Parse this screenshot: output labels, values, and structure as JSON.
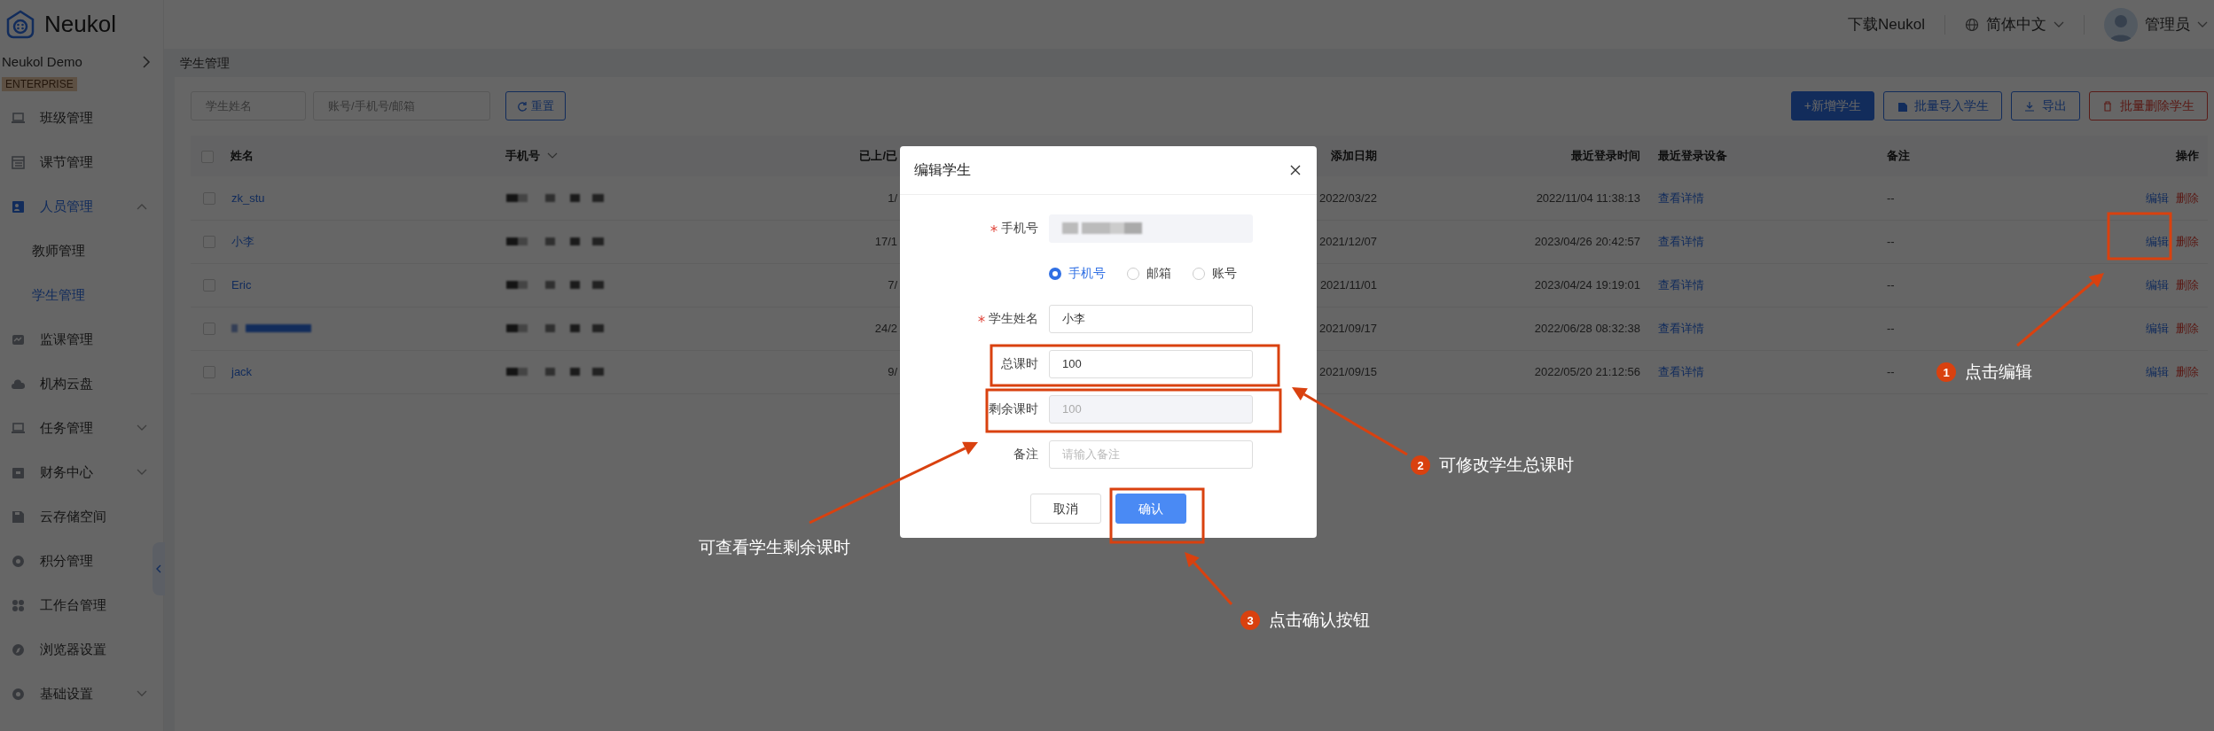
{
  "brand": {
    "name": "Neukol"
  },
  "org": {
    "name": "Neukol Demo",
    "badge": "ENTERPRISE"
  },
  "sidebar": {
    "items": [
      {
        "label": "班级管理",
        "kind": "link",
        "expanded": false,
        "selected": false
      },
      {
        "label": "课节管理",
        "kind": "link",
        "expanded": false,
        "selected": false
      },
      {
        "label": "人员管理",
        "kind": "group",
        "expanded": true,
        "selected": false,
        "children": [
          {
            "label": "教师管理",
            "selected": false
          },
          {
            "label": "学生管理",
            "selected": true
          }
        ]
      },
      {
        "label": "监课管理",
        "kind": "link",
        "expanded": false,
        "selected": false
      },
      {
        "label": "机构云盘",
        "kind": "link",
        "expanded": false,
        "selected": false
      },
      {
        "label": "任务管理",
        "kind": "group",
        "expanded": false,
        "selected": false
      },
      {
        "label": "财务中心",
        "kind": "group",
        "expanded": false,
        "selected": false
      },
      {
        "label": "云存储空间",
        "kind": "link",
        "expanded": false,
        "selected": false
      },
      {
        "label": "积分管理",
        "kind": "link",
        "expanded": false,
        "selected": false
      },
      {
        "label": "工作台管理",
        "kind": "link",
        "expanded": false,
        "selected": false
      },
      {
        "label": "浏览器设置",
        "kind": "link",
        "expanded": false,
        "selected": false
      },
      {
        "label": "基础设置",
        "kind": "group",
        "expanded": false,
        "selected": false
      }
    ]
  },
  "topbar": {
    "download": "下载Neukol",
    "language": "简体中文",
    "user": "管理员"
  },
  "breadcrumb": "学生管理",
  "filters": {
    "name_placeholder": "学生姓名",
    "account_placeholder": "账号/手机号/邮箱",
    "reset": "重置"
  },
  "actions": [
    {
      "label": "+新增学生",
      "kind": "primary"
    },
    {
      "label": "批量导入学生",
      "kind": "import"
    },
    {
      "label": "导出",
      "kind": "export"
    },
    {
      "label": "批量删除学生",
      "kind": "danger"
    }
  ],
  "table": {
    "header_checked": false,
    "columns": [
      "姓名",
      "手机号",
      "已上/已",
      "添加日期",
      "最近登录时间",
      "最近登录设备",
      "备注",
      "操作"
    ],
    "rows": [
      {
        "checked": false,
        "name": "zk_stu",
        "lessons": "1/",
        "added": "2022/03/22",
        "last_login": "2022/11/04 11:38:13",
        "device": "查看详情",
        "note": "--",
        "edit": "编辑",
        "delete": "删除"
      },
      {
        "checked": false,
        "name": "小李",
        "lessons": "17/1",
        "added": "2021/12/07",
        "last_login": "2023/04/26 20:42:57",
        "device": "查看详情",
        "note": "--",
        "edit": "编辑",
        "delete": "删除"
      },
      {
        "checked": false,
        "name": "Eric",
        "lessons": "7/",
        "added": "2021/11/01",
        "last_login": "2023/04/24 19:19:01",
        "device": "查看详情",
        "note": "--",
        "edit": "编辑",
        "delete": "删除"
      },
      {
        "checked": false,
        "lessons": "24/2",
        "added": "2021/09/17",
        "last_login": "2022/06/28 08:32:38",
        "device": "查看详情",
        "note": "--",
        "edit": "编辑",
        "delete": "删除"
      },
      {
        "checked": false,
        "name": "jack",
        "lessons": "9/",
        "added": "2021/09/15",
        "last_login": "2022/05/20 21:12:56",
        "device": "查看详情",
        "note": "--",
        "edit": "编辑",
        "delete": "删除"
      }
    ]
  },
  "modal": {
    "title": "编辑学生",
    "fields": [
      {
        "kind": "redacted",
        "label": "手机号",
        "required": true
      },
      {
        "kind": "radio",
        "options": [
          {
            "label": "手机号",
            "selected": true
          },
          {
            "label": "邮箱",
            "selected": false
          },
          {
            "label": "账号",
            "selected": false
          }
        ]
      },
      {
        "kind": "text",
        "label": "学生姓名",
        "required": true,
        "disabled": false,
        "value": "小李"
      },
      {
        "kind": "text",
        "label": "总课时",
        "required": false,
        "disabled": false,
        "value": "100"
      },
      {
        "kind": "text",
        "label": "剩余课时",
        "required": false,
        "disabled": true,
        "value": "100"
      },
      {
        "kind": "text",
        "label": "备注",
        "required": false,
        "disabled": false,
        "placeholder": "请输入备注"
      }
    ],
    "cancel": "取消",
    "confirm": "确认"
  },
  "annotations": [
    {
      "number": "1",
      "text": "点击编辑"
    },
    {
      "number": "2",
      "text": "可修改学生总课时"
    },
    {
      "text": "可查看学生剩余课时"
    },
    {
      "number": "3",
      "text": "点击确认按钮"
    }
  ]
}
